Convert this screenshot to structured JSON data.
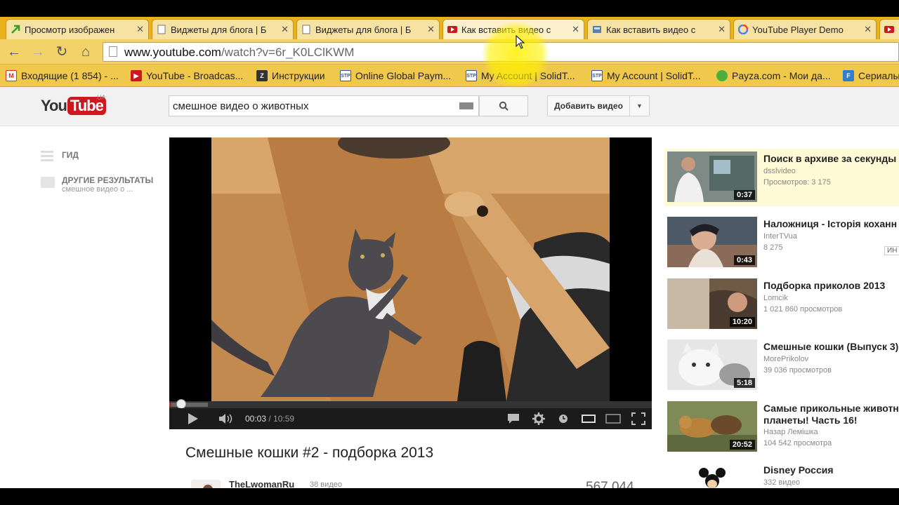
{
  "browser": {
    "tabs": [
      {
        "title": "Просмотр изображен",
        "icon": "green-arrow-icon"
      },
      {
        "title": "Виджеты для блога | Б",
        "icon": "page-icon"
      },
      {
        "title": "Виджеты для блога | Б",
        "icon": "page-icon"
      },
      {
        "title": "Как вставить видео с",
        "icon": "youtube-icon"
      },
      {
        "title": "Как вставить видео с",
        "icon": "site-icon"
      },
      {
        "title": "YouTube Player Demo",
        "icon": "google-icon"
      },
      {
        "title": "",
        "icon": "youtube-icon"
      }
    ],
    "url_host": "www.youtube.com",
    "url_path": "/watch?v=6r_K0LClKWM",
    "bookmarks": [
      {
        "label": "Входящие (1 854) - ...",
        "icon": "gmail-icon"
      },
      {
        "label": "YouTube - Broadcas...",
        "icon": "youtube-icon"
      },
      {
        "label": "Инструкции",
        "icon": "z-icon"
      },
      {
        "label": "Online Global Paym...",
        "icon": "stp-icon"
      },
      {
        "label": "My Account | SolidT...",
        "icon": "stp-icon"
      },
      {
        "label": "My Account | SolidT...",
        "icon": "stp-icon"
      },
      {
        "label": "Payza.com - Мои да...",
        "icon": "payza-icon"
      },
      {
        "label": "Сериалы",
        "icon": "f-icon"
      }
    ]
  },
  "youtube": {
    "logo_you": "You",
    "logo_tube": "Tube",
    "logo_region": "UA",
    "search_value": "смешное видео о животных",
    "upload_label": "Добавить видео",
    "guide": {
      "guide_label": "ГИД",
      "other_label": "ДРУГИЕ РЕЗУЛЬТАТЫ",
      "other_sub": "смешное видео о ..."
    },
    "player": {
      "current_time": "00:03",
      "separator": " / ",
      "duration": "10:59",
      "progress": 0.005,
      "buffered": 0.08
    },
    "video": {
      "title": "Смешные кошки #2 - подборка 2013",
      "owner": "TheLwomanRu",
      "owner_videos": "38 видео",
      "views": "567 044"
    },
    "related": [
      {
        "title": "Поиск в архиве за секунды",
        "channel": "dsslvideo",
        "views": "Просмотров: 3 175",
        "duration": "0:37",
        "highlight": true
      },
      {
        "title": "Наложниця - Історія коханн",
        "channel": "InterTVua",
        "views": "8 275",
        "duration": "0:43",
        "badge": "ИН"
      },
      {
        "title": "Подборка приколов 2013",
        "channel": "Lomcik",
        "views": "1 021 860 просмотров",
        "duration": "10:20"
      },
      {
        "title": "Смешные кошки (Выпуск 3)",
        "channel": "MorePrikolov",
        "views": "39 036 просмотров",
        "duration": "5:18"
      },
      {
        "title": "Самые прикольные животн",
        "title2": "планеты! Часть 16!",
        "channel": "Назар Лемішка",
        "views": "104 542 просмотра",
        "duration": "20:52"
      },
      {
        "title": "Disney Россия",
        "channel": "332 видео",
        "views": "",
        "duration": ""
      }
    ]
  }
}
